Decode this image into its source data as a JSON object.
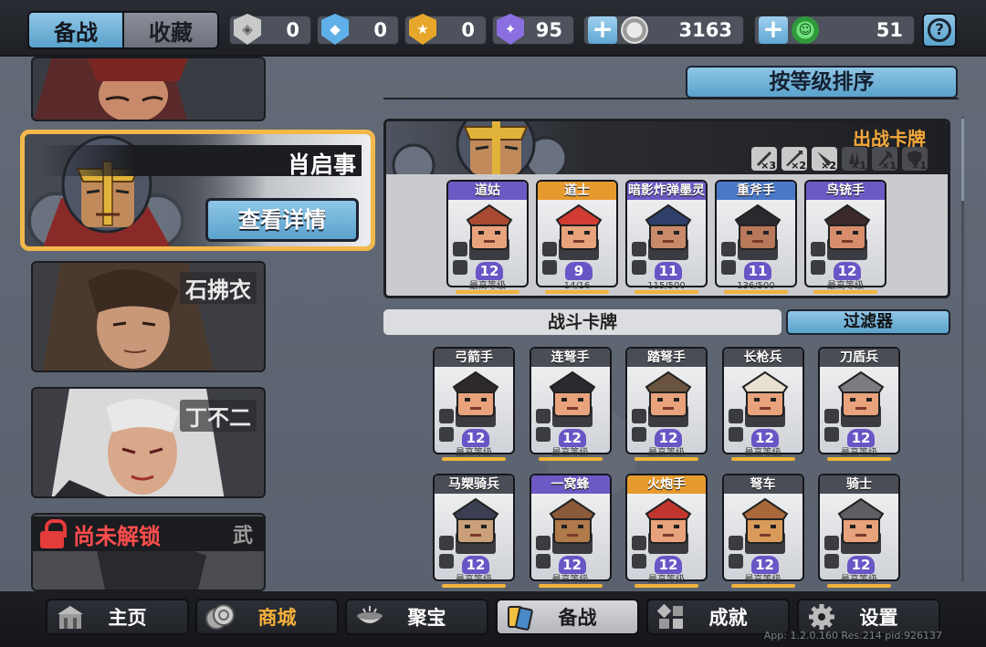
{
  "topbar": {
    "tabs": [
      "备战",
      "收藏"
    ],
    "resources": [
      {
        "icon": "silver-badge-icon",
        "value": "0",
        "color": "#c9c9c9"
      },
      {
        "icon": "blue-crystal-icon",
        "value": "0",
        "color": "#5fb0e8"
      },
      {
        "icon": "gold-badge-icon",
        "value": "0",
        "color": "#e6a72a"
      },
      {
        "icon": "purple-badge-icon",
        "value": "95",
        "color": "#8a6fe0"
      }
    ],
    "coins": {
      "icon": "silver-coin-icon",
      "value": "3163"
    },
    "gems": {
      "icon": "green-gem-icon",
      "value": "51"
    },
    "help": "?"
  },
  "heroes": {
    "selected": {
      "name": "肖启事",
      "detail_button": "查看详情"
    },
    "list": [
      {
        "name": "石拂衣"
      },
      {
        "name": "丁不二"
      }
    ],
    "locked": {
      "text": "尚未解锁",
      "tag": "武"
    }
  },
  "sort_button": "按等级排序",
  "deck": {
    "title": "出战卡牌",
    "stats": [
      {
        "icon": "sword-icon",
        "count": "×3",
        "active": true
      },
      {
        "icon": "spear-icon",
        "count": "×2",
        "active": true
      },
      {
        "icon": "blade-icon",
        "count": "×2",
        "active": true
      },
      {
        "icon": "claw-icon",
        "count": "×1",
        "active": false
      },
      {
        "icon": "axe-icon",
        "count": "×1",
        "active": false
      },
      {
        "icon": "shield-icon",
        "count": "×1",
        "active": false
      }
    ],
    "cards": [
      {
        "name": "道姑",
        "level": "12",
        "sub": "最高等级",
        "header": "#6c59c4",
        "hat": "#a84a32",
        "face": "#e8a27c"
      },
      {
        "name": "道士",
        "level": "9",
        "sub": "14/16",
        "header": "#e69a2e",
        "hat": "#d03c32",
        "face": "#e8a27c"
      },
      {
        "name": "暗影炸弹墨灵",
        "level": "11",
        "sub": "115/500",
        "header": "#6c59c4",
        "hat": "#2f3f6a",
        "face": "#c98a6a"
      },
      {
        "name": "重斧手",
        "level": "11",
        "sub": "136/500",
        "header": "#4a78c8",
        "hat": "#2a2a2e",
        "face": "#b8785a"
      },
      {
        "name": "鸟铳手",
        "level": "12",
        "sub": "最高等级",
        "header": "#6c59c4",
        "hat": "#3b2a2a",
        "face": "#d88e6c"
      }
    ]
  },
  "battle_cards": {
    "title": "战斗卡牌",
    "filter": "过滤器",
    "rows": [
      [
        {
          "name": "弓箭手",
          "level": "12",
          "sub": "最高等级",
          "hat": "#2e2a2c",
          "face": "#e8a27c"
        },
        {
          "name": "连弩手",
          "level": "12",
          "sub": "最高等级",
          "hat": "#2a2a30",
          "face": "#e8a27c"
        },
        {
          "name": "踏弩手",
          "level": "12",
          "sub": "最高等级",
          "hat": "#6a5440",
          "face": "#e8a27c"
        },
        {
          "name": "长枪兵",
          "level": "12",
          "sub": "最高等级",
          "hat": "#e8e0d0",
          "face": "#e8a27c"
        },
        {
          "name": "刀盾兵",
          "level": "12",
          "sub": "最高等级",
          "hat": "#7a7c80",
          "face": "#e8a27c"
        }
      ],
      [
        {
          "name": "马槊骑兵",
          "level": "12",
          "sub": "最高等级",
          "hat": "#3a3f52",
          "face": "#c9a07a"
        },
        {
          "name": "一窝蜂",
          "level": "12",
          "sub": "最高等级",
          "hat": "#8a5a3a",
          "face": "#b07a4a"
        },
        {
          "name": "火炮手",
          "level": "12",
          "sub": "最高等级",
          "hat": "#c0362e",
          "face": "#e8a27c"
        },
        {
          "name": "弩车",
          "level": "12",
          "sub": "最高等级",
          "hat": "#a8683a",
          "face": "#d99a5a"
        },
        {
          "name": "骑士",
          "level": "12",
          "sub": "最高等级",
          "hat": "#5c5e62",
          "face": "#e8a27c"
        }
      ]
    ]
  },
  "nav": [
    {
      "label": "主页",
      "icon": "home-icon",
      "active": false,
      "gold": false
    },
    {
      "label": "商城",
      "icon": "shop-coins-icon",
      "active": false,
      "gold": true
    },
    {
      "label": "聚宝",
      "icon": "treasure-bowl-icon",
      "active": false,
      "gold": false
    },
    {
      "label": "备战",
      "icon": "cards-icon",
      "active": true,
      "gold": false
    },
    {
      "label": "成就",
      "icon": "achievement-grid-icon",
      "active": false,
      "gold": false
    },
    {
      "label": "设置",
      "icon": "gear-icon",
      "active": false,
      "gold": false
    }
  ],
  "build_info": "App: 1.2.0.160 Res:214 pid:926137"
}
